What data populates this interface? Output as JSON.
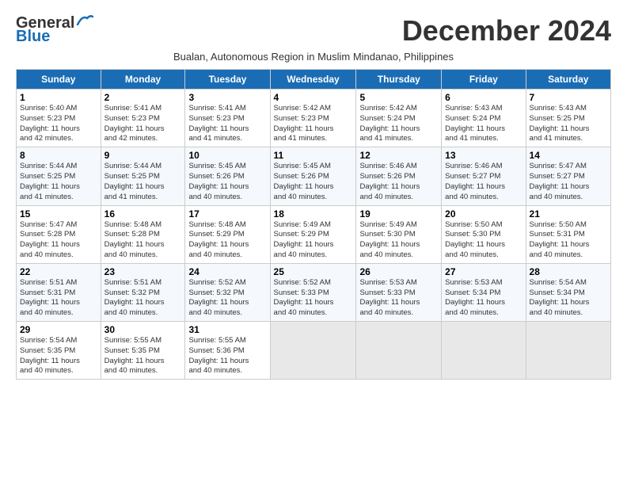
{
  "logo": {
    "line1": "General",
    "line2": "Blue"
  },
  "title": "December 2024",
  "subtitle": "Bualan, Autonomous Region in Muslim Mindanao, Philippines",
  "headers": [
    "Sunday",
    "Monday",
    "Tuesday",
    "Wednesday",
    "Thursday",
    "Friday",
    "Saturday"
  ],
  "weeks": [
    [
      {
        "day": "1",
        "info": "Sunrise: 5:40 AM\nSunset: 5:23 PM\nDaylight: 11 hours\nand 42 minutes."
      },
      {
        "day": "2",
        "info": "Sunrise: 5:41 AM\nSunset: 5:23 PM\nDaylight: 11 hours\nand 42 minutes."
      },
      {
        "day": "3",
        "info": "Sunrise: 5:41 AM\nSunset: 5:23 PM\nDaylight: 11 hours\nand 41 minutes."
      },
      {
        "day": "4",
        "info": "Sunrise: 5:42 AM\nSunset: 5:23 PM\nDaylight: 11 hours\nand 41 minutes."
      },
      {
        "day": "5",
        "info": "Sunrise: 5:42 AM\nSunset: 5:24 PM\nDaylight: 11 hours\nand 41 minutes."
      },
      {
        "day": "6",
        "info": "Sunrise: 5:43 AM\nSunset: 5:24 PM\nDaylight: 11 hours\nand 41 minutes."
      },
      {
        "day": "7",
        "info": "Sunrise: 5:43 AM\nSunset: 5:25 PM\nDaylight: 11 hours\nand 41 minutes."
      }
    ],
    [
      {
        "day": "8",
        "info": "Sunrise: 5:44 AM\nSunset: 5:25 PM\nDaylight: 11 hours\nand 41 minutes."
      },
      {
        "day": "9",
        "info": "Sunrise: 5:44 AM\nSunset: 5:25 PM\nDaylight: 11 hours\nand 41 minutes."
      },
      {
        "day": "10",
        "info": "Sunrise: 5:45 AM\nSunset: 5:26 PM\nDaylight: 11 hours\nand 40 minutes."
      },
      {
        "day": "11",
        "info": "Sunrise: 5:45 AM\nSunset: 5:26 PM\nDaylight: 11 hours\nand 40 minutes."
      },
      {
        "day": "12",
        "info": "Sunrise: 5:46 AM\nSunset: 5:26 PM\nDaylight: 11 hours\nand 40 minutes."
      },
      {
        "day": "13",
        "info": "Sunrise: 5:46 AM\nSunset: 5:27 PM\nDaylight: 11 hours\nand 40 minutes."
      },
      {
        "day": "14",
        "info": "Sunrise: 5:47 AM\nSunset: 5:27 PM\nDaylight: 11 hours\nand 40 minutes."
      }
    ],
    [
      {
        "day": "15",
        "info": "Sunrise: 5:47 AM\nSunset: 5:28 PM\nDaylight: 11 hours\nand 40 minutes."
      },
      {
        "day": "16",
        "info": "Sunrise: 5:48 AM\nSunset: 5:28 PM\nDaylight: 11 hours\nand 40 minutes."
      },
      {
        "day": "17",
        "info": "Sunrise: 5:48 AM\nSunset: 5:29 PM\nDaylight: 11 hours\nand 40 minutes."
      },
      {
        "day": "18",
        "info": "Sunrise: 5:49 AM\nSunset: 5:29 PM\nDaylight: 11 hours\nand 40 minutes."
      },
      {
        "day": "19",
        "info": "Sunrise: 5:49 AM\nSunset: 5:30 PM\nDaylight: 11 hours\nand 40 minutes."
      },
      {
        "day": "20",
        "info": "Sunrise: 5:50 AM\nSunset: 5:30 PM\nDaylight: 11 hours\nand 40 minutes."
      },
      {
        "day": "21",
        "info": "Sunrise: 5:50 AM\nSunset: 5:31 PM\nDaylight: 11 hours\nand 40 minutes."
      }
    ],
    [
      {
        "day": "22",
        "info": "Sunrise: 5:51 AM\nSunset: 5:31 PM\nDaylight: 11 hours\nand 40 minutes."
      },
      {
        "day": "23",
        "info": "Sunrise: 5:51 AM\nSunset: 5:32 PM\nDaylight: 11 hours\nand 40 minutes."
      },
      {
        "day": "24",
        "info": "Sunrise: 5:52 AM\nSunset: 5:32 PM\nDaylight: 11 hours\nand 40 minutes."
      },
      {
        "day": "25",
        "info": "Sunrise: 5:52 AM\nSunset: 5:33 PM\nDaylight: 11 hours\nand 40 minutes."
      },
      {
        "day": "26",
        "info": "Sunrise: 5:53 AM\nSunset: 5:33 PM\nDaylight: 11 hours\nand 40 minutes."
      },
      {
        "day": "27",
        "info": "Sunrise: 5:53 AM\nSunset: 5:34 PM\nDaylight: 11 hours\nand 40 minutes."
      },
      {
        "day": "28",
        "info": "Sunrise: 5:54 AM\nSunset: 5:34 PM\nDaylight: 11 hours\nand 40 minutes."
      }
    ],
    [
      {
        "day": "29",
        "info": "Sunrise: 5:54 AM\nSunset: 5:35 PM\nDaylight: 11 hours\nand 40 minutes."
      },
      {
        "day": "30",
        "info": "Sunrise: 5:55 AM\nSunset: 5:35 PM\nDaylight: 11 hours\nand 40 minutes."
      },
      {
        "day": "31",
        "info": "Sunrise: 5:55 AM\nSunset: 5:36 PM\nDaylight: 11 hours\nand 40 minutes."
      },
      {
        "day": "",
        "info": ""
      },
      {
        "day": "",
        "info": ""
      },
      {
        "day": "",
        "info": ""
      },
      {
        "day": "",
        "info": ""
      }
    ]
  ]
}
